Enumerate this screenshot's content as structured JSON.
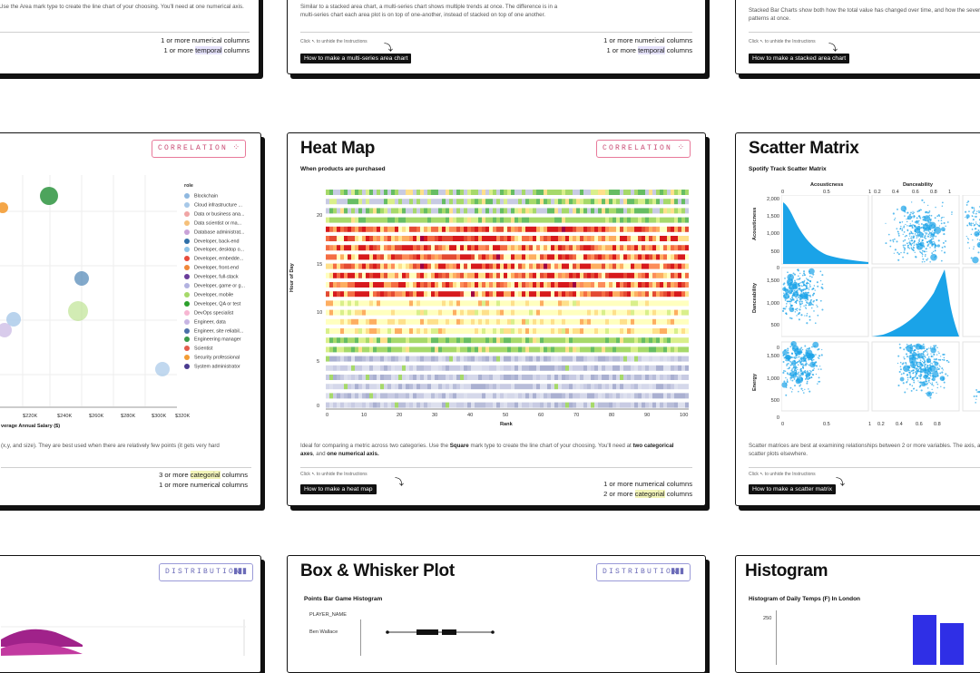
{
  "top_cards": [
    {
      "desc": "Use the Area mark type to create the line chart of your choosing. You'll need at one numerical axis.",
      "req_1": "1 or more numerical columns",
      "req_2_prefix": "1 or more ",
      "req_2_hl": "temporal",
      "req_2_suffix": " columns"
    },
    {
      "desc": "Similar to a stacked area chart, a multi-series chart shows multiple trends at once. The difference is in a multi-series chart each area plot is on top of one-another, instead of stacked on top of one another.",
      "click_text": "Click  ↖  to unhide the Instructions",
      "howto": "How to make a multi-series area chart",
      "req_1": "1 or more numerical columns",
      "req_2_prefix": "1 or more ",
      "req_2_hl": "temporal",
      "req_2_suffix": " columns"
    },
    {
      "desc": "Stacked Bar Charts show both how the total value has changed over time, and how the several patterns at once.",
      "click_text": "Click  ↖  to unhide the Instructions",
      "howto": "How to make a stacked area chart"
    }
  ],
  "bubble_card": {
    "badge": "CORRELATION",
    "legend_title": "role",
    "legend": [
      {
        "label": "Blockchain",
        "color": "#8fb8e0"
      },
      {
        "label": "Cloud infrastructure ...",
        "color": "#a7c8e8"
      },
      {
        "label": "Data or business ana...",
        "color": "#f0a5a5"
      },
      {
        "label": "Data scientist or ma...",
        "color": "#f5c07a"
      },
      {
        "label": "Database administrat...",
        "color": "#c9a2d8"
      },
      {
        "label": "Developer, back-end",
        "color": "#2f6fa8"
      },
      {
        "label": "Developer, desktop o...",
        "color": "#8fc4e8"
      },
      {
        "label": "Developer, embedde...",
        "color": "#e74c3c"
      },
      {
        "label": "Developer, front-end",
        "color": "#f0883a"
      },
      {
        "label": "Developer, full-stack",
        "color": "#6a3d9a"
      },
      {
        "label": "Developer, game or g...",
        "color": "#b2b2e0"
      },
      {
        "label": "Developer, mobile",
        "color": "#a6d96a"
      },
      {
        "label": "Developer, QA or test",
        "color": "#2ca02c"
      },
      {
        "label": "DevOps specialist",
        "color": "#f7b6d2"
      },
      {
        "label": "Engineer, data",
        "color": "#c7b5e3"
      },
      {
        "label": "Engineer, site reliabil...",
        "color": "#4b6fa8"
      },
      {
        "label": "Engineering manager",
        "color": "#3a9a4a"
      },
      {
        "label": "Scientist",
        "color": "#e35d4c"
      },
      {
        "label": "Security professional",
        "color": "#f39c34"
      },
      {
        "label": "System administrator",
        "color": "#4a3b8f"
      }
    ],
    "x_ticks": [
      "$220K",
      "$240K",
      "$260K",
      "$280K",
      "$300K",
      "$320K"
    ],
    "x_title": "verage Annual Salary ($)",
    "desc": "(x,y, and size). They are best used when there are relatively few points (it gets very hard",
    "req_1_prefix": "3 or more ",
    "req_1_hl": "categorial",
    "req_1_suffix": " columns",
    "req_2": "1 or more numerical columns"
  },
  "heatmap_card": {
    "title": "Heat Map",
    "badge": "CORRELATION",
    "subtitle": "When products are purchased",
    "y_title": "Hour of Day",
    "x_title": "Rank",
    "y_ticks": [
      "20",
      "15",
      "10",
      "5",
      "0"
    ],
    "x_ticks": [
      "0",
      "10",
      "20",
      "30",
      "40",
      "50",
      "60",
      "70",
      "80",
      "90",
      "100"
    ],
    "desc_1": "Ideal for comparing a metric across two categories. Use the ",
    "desc_b1": "Square",
    "desc_2": " mark type to create the line chart of your choosing. You'll need at ",
    "desc_b2": "two categorical axes",
    "desc_3": ", and ",
    "desc_b3": "one numerical axis.",
    "click_text": "Click  ↖  to unhide the Instructions",
    "howto": "How to make a heat map",
    "req_1": "1 or more numerical columns",
    "req_2_prefix": "2 or more ",
    "req_2_hl": "categorial",
    "req_2_suffix": " columns"
  },
  "scatter_card": {
    "title": "Scatter Matrix",
    "subtitle": "Spotify Track Scatter Matrix",
    "col_titles": [
      "Acousticness",
      "Danceability"
    ],
    "row_titles": [
      "Acousticness",
      "Danceability",
      "Energy"
    ],
    "col1_ticks": [
      "0",
      "0.5",
      "1"
    ],
    "col2_ticks": [
      "0.2",
      "0.4",
      "0.6",
      "0.8",
      "1"
    ],
    "row1_ticks": [
      "2,000",
      "1,500",
      "1,000",
      "500",
      "0"
    ],
    "row2_ticks": [
      "1,500",
      "1,000",
      "500",
      "0"
    ],
    "row3_ticks": [
      "1,500",
      "1,000",
      "500",
      "0"
    ],
    "bottom_ticks_1": [
      "0",
      "0.5",
      "1"
    ],
    "bottom_ticks_2": [
      "0.2",
      "0.4",
      "0.6",
      "0.8"
    ],
    "desc": "Scatter matrices are best at examining relationships between 2 or more variables. The axis, and scatter plots elsewhere.",
    "click_text": "Click  ↖  to unhide the Instructions",
    "howto": "How to make a scatter matrix"
  },
  "bottom_left_card": {
    "badge": "DISTRIBUTION"
  },
  "box_card": {
    "title": "Box & Whisker Plot",
    "badge": "DISTRIBUTION",
    "subtitle": "Points Bar Game Histogram",
    "col_label": "PLAYER_NAME",
    "row_label": "Ben Wallace"
  },
  "histogram_card": {
    "title": "Histogram",
    "subtitle": "Histogram of Daily Temps (F) In London",
    "y_tick": "250"
  },
  "colors": {
    "accent_blue": "#1aa3e8",
    "hist_blue": "#2f2fe6",
    "correlation_pink": "#e8799a",
    "distribution_purple": "#9a9ad8"
  }
}
